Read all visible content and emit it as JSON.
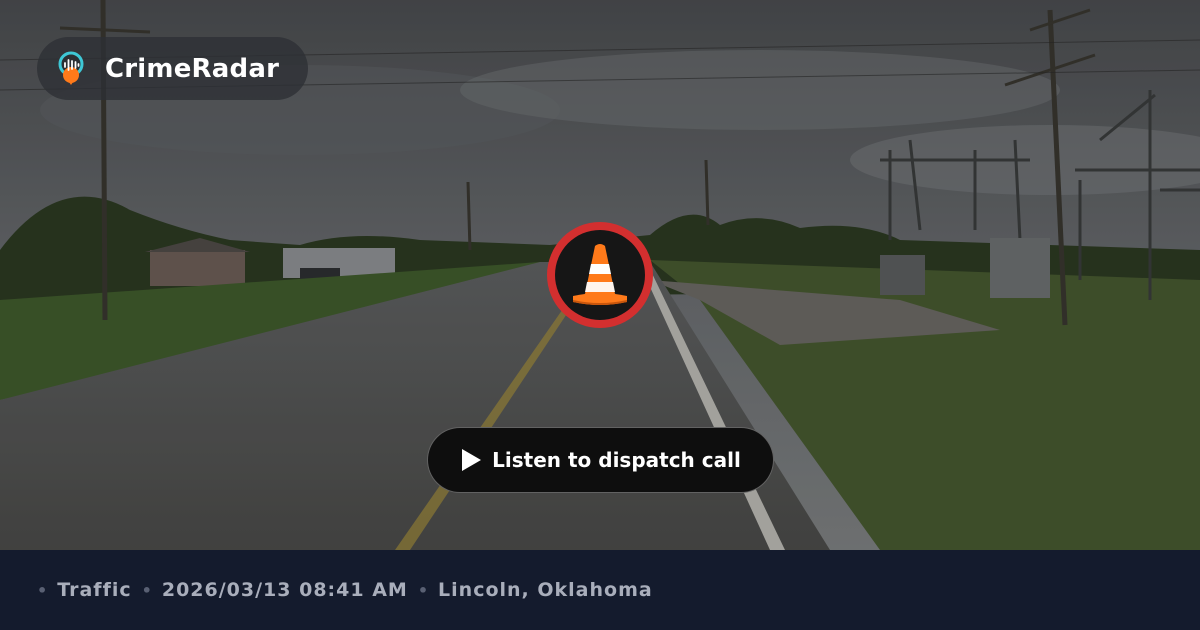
{
  "brand": {
    "name": "CrimeRadar",
    "logo_icon": "location-pin-soundwave-icon"
  },
  "incident": {
    "icon": "traffic-cone-icon",
    "badge_color": "#d32f2f"
  },
  "listen_button": {
    "label": "Listen to dispatch call",
    "icon": "play-icon"
  },
  "meta": {
    "separator": "•",
    "category": "Traffic",
    "datetime": "2026/03/13 08:41 AM",
    "location": "Lincoln, Oklahoma"
  },
  "colors": {
    "footer_bg": "#141b2d",
    "footer_text": "#a9aebb",
    "accent_red": "#d32f2f",
    "cone_orange": "#ff7a1a"
  }
}
